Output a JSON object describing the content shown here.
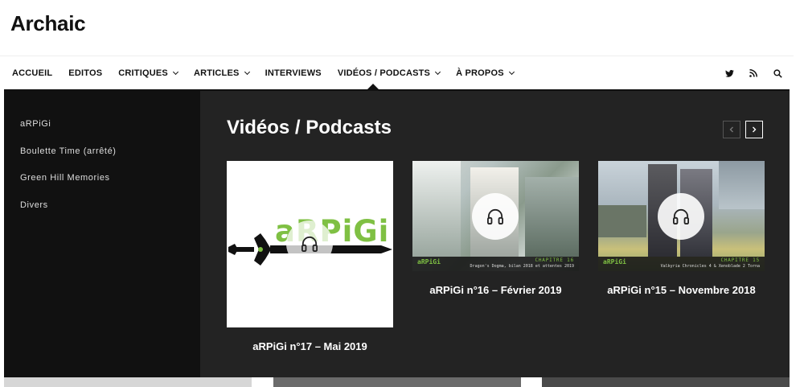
{
  "site": {
    "title": "Archaic"
  },
  "nav": {
    "items": [
      {
        "label": "Accueil",
        "dropdown": false
      },
      {
        "label": "Editos",
        "dropdown": false
      },
      {
        "label": "Critiques",
        "dropdown": true
      },
      {
        "label": "Articles",
        "dropdown": true
      },
      {
        "label": "Interviews",
        "dropdown": false
      },
      {
        "label": "Vidéos / Podcasts",
        "dropdown": true
      },
      {
        "label": "À propos",
        "dropdown": true
      }
    ],
    "icons": [
      "twitter-icon",
      "rss-icon",
      "search-icon"
    ]
  },
  "mega_menu": {
    "title": "Vidéos / Podcasts",
    "sidebar": [
      "aRPiGi",
      "Boulette Time (arrêté)",
      "Green Hill Memories",
      "Divers"
    ],
    "cards": [
      {
        "title": "aRPiGi n°17 – Mai 2019",
        "logo_text": "aRPiGi"
      },
      {
        "title": "aRPiGi n°16 – Février 2019",
        "logo_text": "aRPiGi",
        "chapter": "CHAPITRE 16",
        "subtitle": "Dragon's Dogma, bilan 2018 et attentes 2019"
      },
      {
        "title": "aRPiGi n°15 – Novembre 2018",
        "logo_text": "aRPiGi",
        "chapter": "CHAPITRE 15",
        "subtitle": "Valkyria Chronicles 4 & Xenoblade 2 Torna"
      }
    ]
  },
  "colors": {
    "accent_green": "#7fc043",
    "menu_bg": "#232323",
    "sidebar_bg": "#111111"
  }
}
